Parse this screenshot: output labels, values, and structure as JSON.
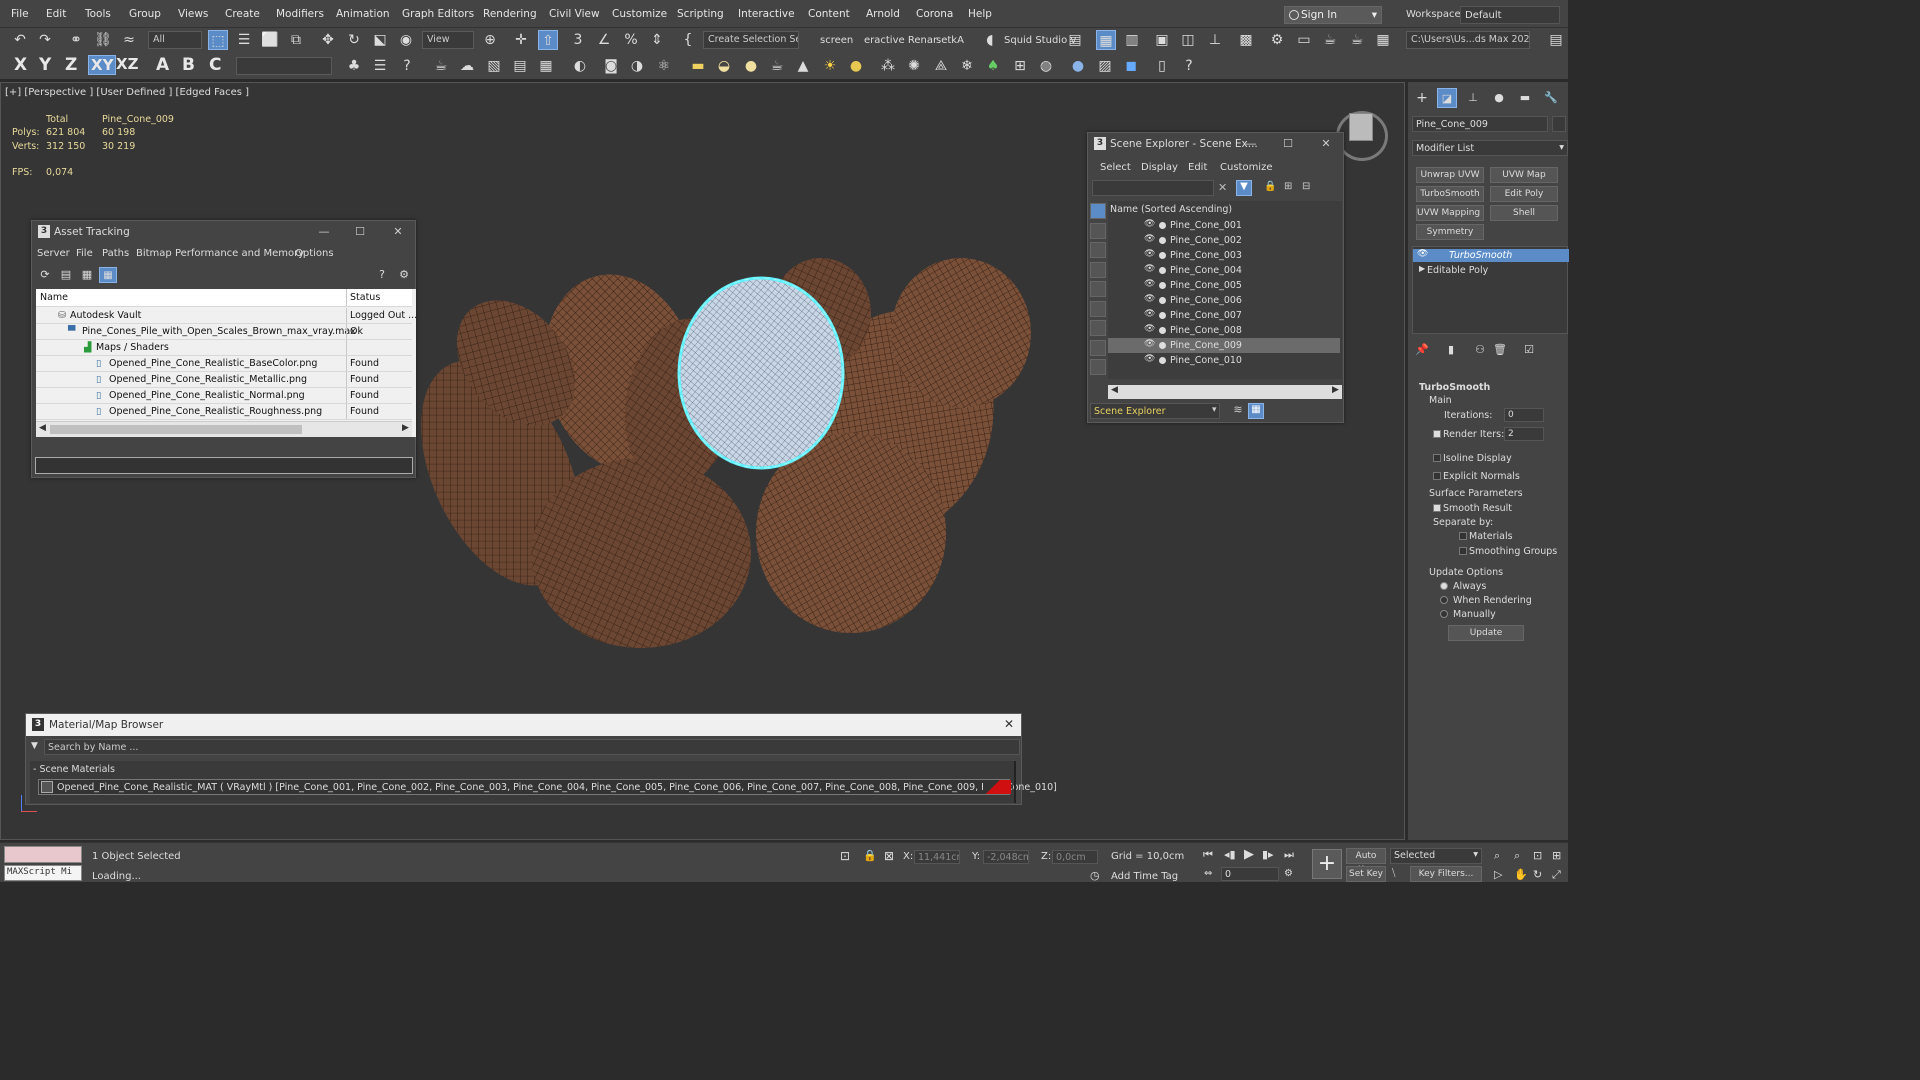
{
  "menu": [
    "File",
    "Edit",
    "Tools",
    "Group",
    "Views",
    "Create",
    "Modifiers",
    "Animation",
    "Graph Editors",
    "Rendering",
    "Civil View",
    "Customize",
    "Scripting",
    "Interactive",
    "Content",
    "Arnold",
    "Corona",
    "Help"
  ],
  "signin": "Sign In",
  "workspaces_label": "Workspaces:",
  "workspace_value": "Default",
  "toolbar": {
    "filter": "All",
    "refcoord": "View",
    "selection_set": "Create Selection Se",
    "screen": "screen",
    "interactive_render": "eractive Renar",
    "setka": "setkA",
    "squid": "Squid Studio v",
    "path": "C:\\Users\\Us...ds Max 2020",
    "axis_x": "X",
    "axis_y": "Y",
    "axis_z": "Z",
    "axis_xy": "XY",
    "axis_xz": "XZ"
  },
  "viewport": {
    "label": "[+] [Perspective ] [User Defined ] [Edged Faces ]",
    "stats": {
      "total_label": "Total",
      "object_label": "Pine_Cone_009",
      "polys_label": "Polys:",
      "polys_total": "621 804",
      "polys_obj": "60 198",
      "verts_label": "Verts:",
      "verts_total": "312 150",
      "verts_obj": "30 219",
      "fps_label": "FPS:",
      "fps": "0,074"
    }
  },
  "asset_tracking": {
    "title": "Asset Tracking",
    "menu": [
      "Server",
      "File",
      "Paths",
      "Bitmap Performance and Memory",
      "Options"
    ],
    "col_name": "Name",
    "col_status": "Status",
    "rows": [
      {
        "name": "Autodesk Vault",
        "status": "Logged Out ..."
      },
      {
        "name": "Pine_Cones_Pile_with_Open_Scales_Brown_max_vray.max",
        "status": "Ok"
      },
      {
        "name": "Maps / Shaders",
        "status": ""
      },
      {
        "name": "Opened_Pine_Cone_Realistic_BaseColor.png",
        "status": "Found"
      },
      {
        "name": "Opened_Pine_Cone_Realistic_Metallic.png",
        "status": "Found"
      },
      {
        "name": "Opened_Pine_Cone_Realistic_Normal.png",
        "status": "Found"
      },
      {
        "name": "Opened_Pine_Cone_Realistic_Roughness.png",
        "status": "Found"
      }
    ]
  },
  "scene_explorer": {
    "title": "Scene Explorer - Scene Ex...",
    "menu": [
      "Select",
      "Display",
      "Edit",
      "Customize"
    ],
    "header": "Name (Sorted Ascending)",
    "items": [
      "Pine_Cone_001",
      "Pine_Cone_002",
      "Pine_Cone_003",
      "Pine_Cone_004",
      "Pine_Cone_005",
      "Pine_Cone_006",
      "Pine_Cone_007",
      "Pine_Cone_008",
      "Pine_Cone_009",
      "Pine_Cone_010"
    ],
    "selected_index": 8,
    "footer": "Scene Explorer"
  },
  "command_panel": {
    "object_name": "Pine_Cone_009",
    "modifier_list": "Modifier List",
    "buttons": [
      "Unwrap UVW",
      "UVW Map",
      "TurboSmooth",
      "Edit Poly",
      "UVW Mapping Clear",
      "Shell",
      "Symmetry"
    ],
    "stack": [
      "TurboSmooth",
      "Editable Poly"
    ],
    "rollout_title": "TurboSmooth",
    "main_label": "Main",
    "iterations_label": "Iterations:",
    "iterations": "0",
    "render_iters_label": "Render Iters:",
    "render_iters": "2",
    "isoline": "Isoline Display",
    "explicit_normals": "Explicit Normals",
    "surface_params": "Surface Parameters",
    "smooth_result": "Smooth Result",
    "separate_by": "Separate by:",
    "materials": "Materials",
    "smoothing_groups": "Smoothing Groups",
    "update_options": "Update Options",
    "always": "Always",
    "when_rendering": "When Rendering",
    "manually": "Manually",
    "update_btn": "Update"
  },
  "material_browser": {
    "title": "Material/Map Browser",
    "search_placeholder": "Search by Name ...",
    "section": "- Scene Materials",
    "material": "Opened_Pine_Cone_Realistic_MAT  ( VRayMtl )  [Pine_Cone_001, Pine_Cone_002, Pine_Cone_003, Pine_Cone_004, Pine_Cone_005, Pine_Cone_006, Pine_Cone_007, Pine_Cone_008, Pine_Cone_009, Pine_Cone_010]"
  },
  "status": {
    "maxscript": "MAXScript Mi",
    "selected": "1 Object Selected",
    "loading": "Loading...",
    "x_label": "X:",
    "x_val": "11,441cm",
    "y_label": "Y:",
    "y_val": "-2,048cm",
    "z_label": "Z:",
    "z_val": "0,0cm",
    "grid": "Grid = 10,0cm",
    "add_time_tag": "Add Time Tag",
    "frame": "0",
    "auto_key": "Auto Key",
    "set_key": "Set Key",
    "selected_dd": "Selected",
    "key_filters": "Key Filters..."
  }
}
